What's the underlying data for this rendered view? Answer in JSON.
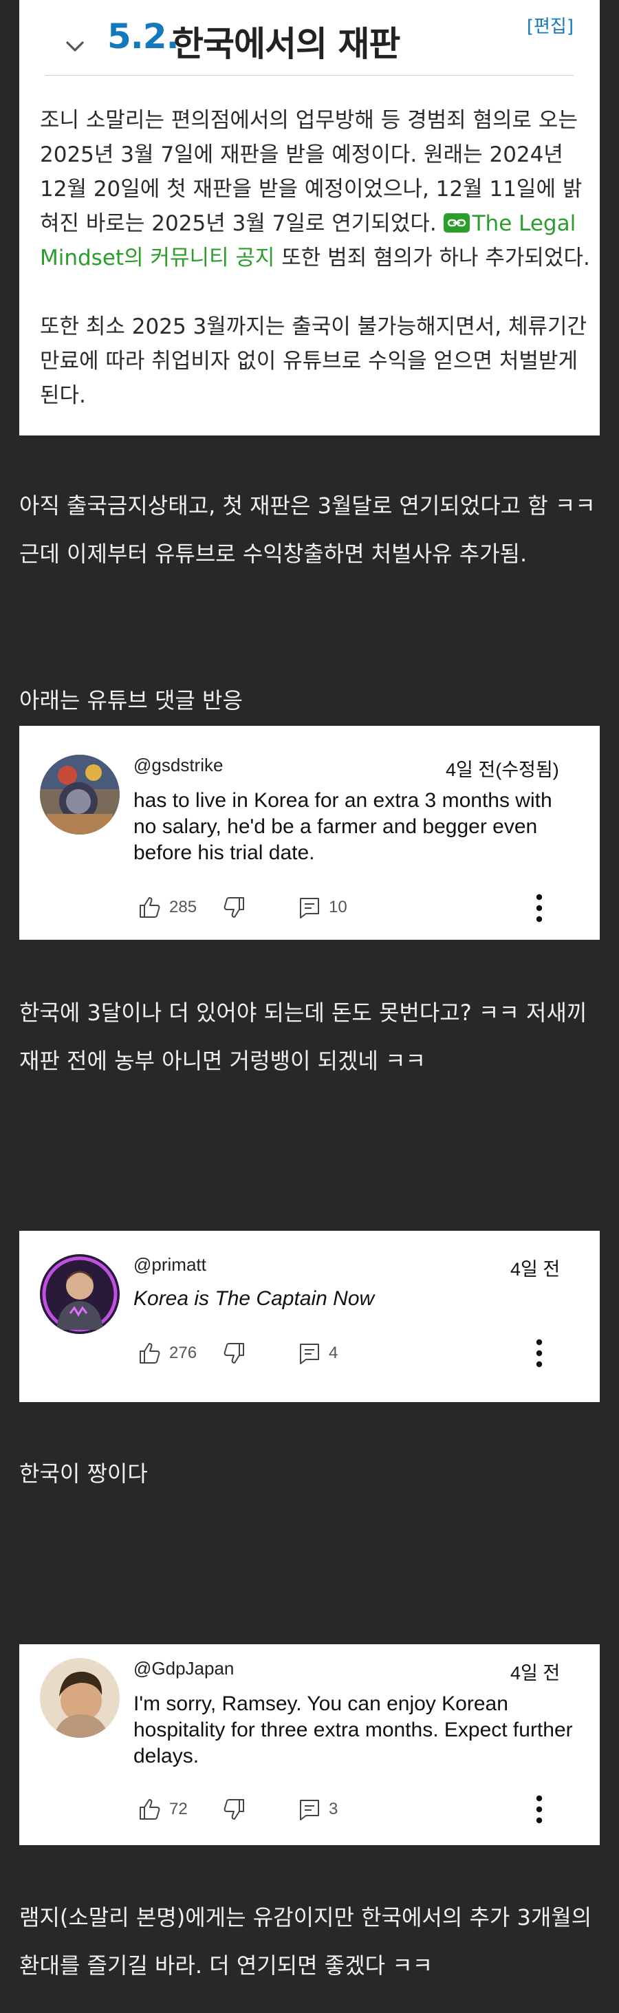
{
  "wiki": {
    "section_number": "5.2.",
    "section_title": "한국에서의 재판",
    "edit_label": "[편집]",
    "paragraph1": {
      "text_before": "조니 소말리는 편의점에서의 업무방해 등 경범죄 혐의로 오는 2025년 3월 7일에 재판을 받을 예정이다. 원래는 2024년 12월 20일에 첫 재판을 받을 예정이었으나, 12월 11일에 밝혀진 바로는 2025년 3월 7일로 연기되었다.",
      "link_text": "The Legal Mindset의 커뮤니티 공지",
      "text_after": " 또한 범죄 혐의가 하나 추가되었다."
    },
    "paragraph2": "또한 최소 2025 3월까지는 출국이 불가능해지면서, 체류기간 만료에 따라 취업비자 없이 유튜브로 수익을 얻으면 처벌받게 된다."
  },
  "posts": {
    "text1_line1": "아직 출국금지상태고, 첫 재판은 3월달로 연기되었다고 함 ㅋㅋ",
    "text1_line2": "근데 이제부터 유튜브로 수익창출하면 처벌사유 추가됨.",
    "text2": "아래는 유튜브 댓글 반응",
    "text3_line1": "한국에 3달이나 더 있어야 되는데 돈도 못번다고? ㅋㅋ 저새끼",
    "text3_line2": "재판 전에 농부 아니면 거렁뱅이 되겠네 ㅋㅋ",
    "text4": "한국이 짱이다",
    "text5_line1": "램지(소말리 본명)에게는 유감이지만 한국에서의 추가 3개월의",
    "text5_line2": "환대를 즐기길 바라. 더 연기되면 좋겠다 ㅋㅋ"
  },
  "comments": [
    {
      "handle": "@gsdstrike",
      "time": "4일 전(수정됨)",
      "text": "has to live in Korea for an extra 3 months with no salary, he'd be a farmer and begger even before his trial date.",
      "likes": "285",
      "replies": "10"
    },
    {
      "handle": "@primatt",
      "time": "4일 전",
      "text": "Korea is The Captain Now",
      "likes": "276",
      "replies": "4"
    },
    {
      "handle": "@GdpJapan",
      "time": "4일 전",
      "text": "I'm sorry, Ramsey. You can enjoy Korean hospitality for three extra months. Expect further delays.",
      "likes": "72",
      "replies": "3"
    }
  ],
  "colors": {
    "background": "#282828",
    "wiki_accent": "#1478bd",
    "link_green": "#2a9d2a"
  },
  "icons": [
    "chevron-down-icon",
    "external-link-icon",
    "like-icon",
    "dislike-icon",
    "reply-icon",
    "more-vert-icon"
  ]
}
